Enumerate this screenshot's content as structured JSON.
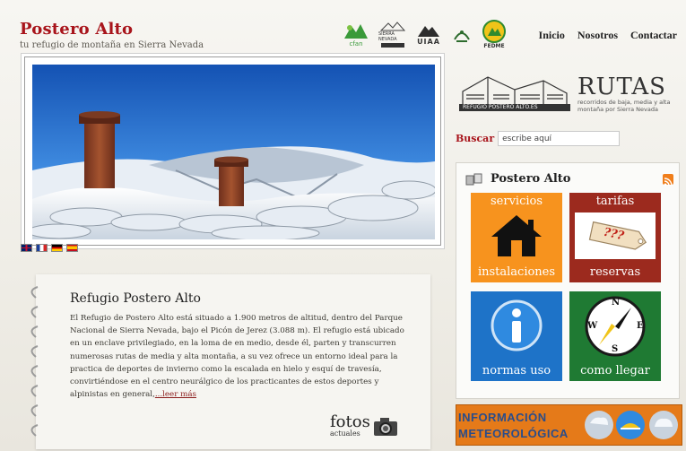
{
  "header": {
    "title": "Postero Alto",
    "subtitle": "tu refugio de montaña en Sierra Nevada"
  },
  "logos": [
    {
      "name": "CFAN logo",
      "text": "cfan"
    },
    {
      "name": "Sierra Nevada logo",
      "text": "SIERRA NEVADA"
    },
    {
      "name": "UIAA logo",
      "text": "UIAA"
    },
    {
      "name": "Junta logo",
      "text": ""
    },
    {
      "name": "FEDME logo",
      "text": "FEDME"
    }
  ],
  "nav": {
    "inicio": "Inicio",
    "nosotros": "Nosotros",
    "contactar": "Contactar"
  },
  "article": {
    "title": "Refugio Postero Alto",
    "body": "El Refugio de Postero Alto está situado a 1.900 metros de altitud, dentro del Parque Nacional de Sierra Nevada, bajo el Picón de Jerez (3.088 m). El refugio está ubicado en un enclave privilegiado, en la loma de en medio, desde él, parten y transcurren numerosas rutas de media y alta montaña, a su vez ofrece un entorno ideal para la practica de deportes de invierno como la escalada en hielo y esquí de travesía, convirtiéndose en el centro neurálgico de los practicantes de estos deportes y alpinistas en general,",
    "more": "...leer más"
  },
  "fotos": {
    "line1": "fotos",
    "line2": "actuales"
  },
  "rutas": {
    "brand": "REFUGIO POSTERO ALTO.ES",
    "title": "RUTAS",
    "desc": "recorridos de baja, media y alta montaña por Sierra Nevada"
  },
  "search": {
    "label": "Buscar",
    "value": "escribe aquí"
  },
  "panel": {
    "title": "Postero Alto"
  },
  "tiles": {
    "servicios": {
      "top": "servicios",
      "bottom": "instalaciones",
      "color": "#f7931e"
    },
    "tarifas": {
      "top": "tarifas",
      "bottom": "reservas",
      "color": "#9c2a1e",
      "tag": "???"
    },
    "normas": {
      "bottom": "normas uso",
      "color": "#1e73c8"
    },
    "llegar": {
      "bottom": "como llegar",
      "color": "#1f7a33",
      "compass": {
        "n": "N",
        "e": "E",
        "s": "S",
        "w": "W"
      }
    }
  },
  "weather": {
    "line1": "INFORMACIÓN",
    "line2": "METEOROLÓGICA"
  },
  "colors": {
    "brand_red": "#a8141b",
    "orange": "#f7931e",
    "sky": "#1c64b8"
  }
}
